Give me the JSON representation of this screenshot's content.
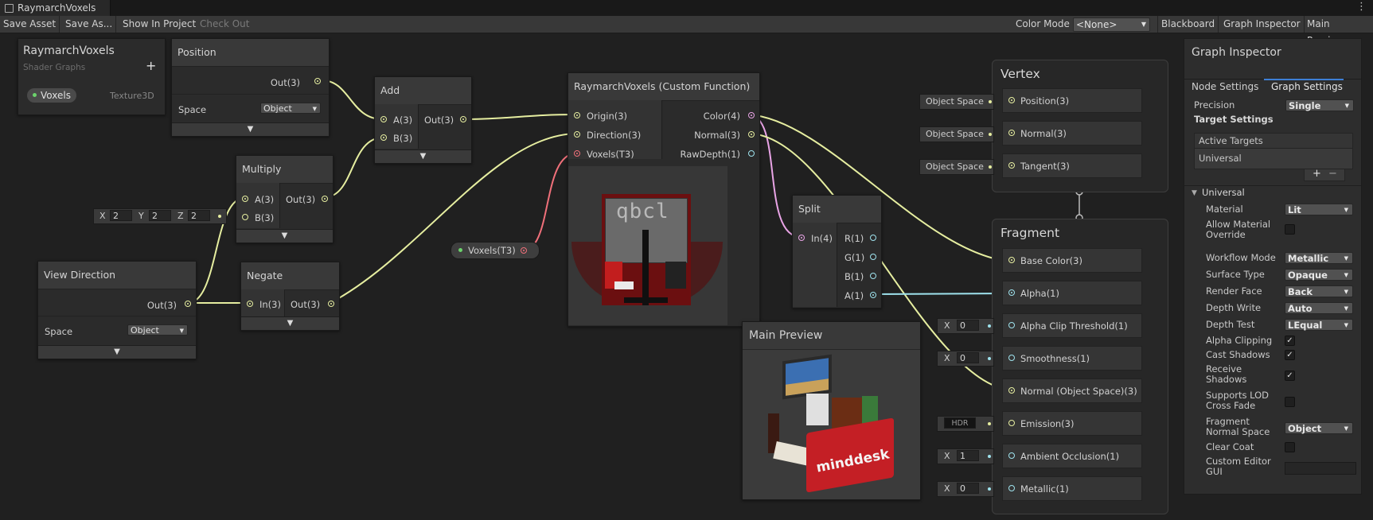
{
  "window": {
    "tab_title": "RaymarchVoxels"
  },
  "toolbar": {
    "save_asset": "Save Asset",
    "save_as": "Save As...",
    "show_in_project": "Show In Project",
    "check_out": "Check Out",
    "color_mode_label": "Color Mode",
    "color_mode_value": "<None>",
    "blackboard": "Blackboard",
    "graph_inspector": "Graph Inspector",
    "main_preview": "Main Preview"
  },
  "blackboard": {
    "title": "RaymarchVoxels",
    "subtitle": "Shader Graphs",
    "add": "+",
    "property_name": "Voxels",
    "property_type": "Texture3D"
  },
  "nodes": {
    "position": {
      "title": "Position",
      "out": "Out(3)",
      "space_label": "Space",
      "space_value": "Object"
    },
    "add": {
      "title": "Add",
      "a": "A(3)",
      "b": "B(3)",
      "out": "Out(3)"
    },
    "multiply": {
      "title": "Multiply",
      "a": "A(3)",
      "b": "B(3)",
      "out": "Out(3)",
      "x_label": "X",
      "x": "2",
      "y_label": "Y",
      "y": "2",
      "z_label": "Z",
      "z": "2"
    },
    "view_direction": {
      "title": "View Direction",
      "out": "Out(3)",
      "space_label": "Space",
      "space_value": "Object"
    },
    "negate": {
      "title": "Negate",
      "in": "In(3)",
      "out": "Out(3)"
    },
    "voxels_property": {
      "label": "Voxels(T3)"
    },
    "custom_function": {
      "title": "RaymarchVoxels (Custom Function)",
      "in_origin": "Origin(3)",
      "in_direction": "Direction(3)",
      "in_voxels": "Voxels(T3)",
      "out_color": "Color(4)",
      "out_normal": "Normal(3)",
      "out_rawdepth": "RawDepth(1)",
      "preview_text": "qbcl"
    },
    "split": {
      "title": "Split",
      "in": "In(4)",
      "r": "R(1)",
      "g": "G(1)",
      "b": "B(1)",
      "a": "A(1)"
    }
  },
  "main_preview": {
    "title": "Main Preview",
    "sign_text": "minddesk"
  },
  "vertex": {
    "title": "Vertex",
    "blocks": [
      {
        "label": "Position(3)",
        "default": "Object Space"
      },
      {
        "label": "Normal(3)",
        "default": "Object Space"
      },
      {
        "label": "Tangent(3)",
        "default": "Object Space"
      }
    ]
  },
  "fragment": {
    "title": "Fragment",
    "blocks": [
      {
        "label": "Base Color(3)"
      },
      {
        "label": "Alpha(1)"
      },
      {
        "label": "Alpha Clip Threshold(1)",
        "x_label": "X",
        "value": "0"
      },
      {
        "label": "Smoothness(1)",
        "x_label": "X",
        "value": "0"
      },
      {
        "label": "Normal (Object Space)(3)"
      },
      {
        "label": "Emission(3)",
        "hdr": "HDR"
      },
      {
        "label": "Ambient Occlusion(1)",
        "x_label": "X",
        "value": "1"
      },
      {
        "label": "Metallic(1)",
        "x_label": "X",
        "value": "0"
      }
    ]
  },
  "inspector": {
    "title": "Graph Inspector",
    "tab_node": "Node Settings",
    "tab_graph": "Graph Settings",
    "precision_label": "Precision",
    "precision_value": "Single",
    "target_settings": "Target Settings",
    "active_targets": "Active Targets",
    "target_universal": "Universal",
    "add": "+",
    "remove": "−",
    "section_universal": "Universal",
    "material_label": "Material",
    "material_value": "Lit",
    "allow_override_label": "Allow Material Override",
    "workflow_label": "Workflow Mode",
    "workflow_value": "Metallic",
    "surface_label": "Surface Type",
    "surface_value": "Opaque",
    "render_face_label": "Render Face",
    "render_face_value": "Back",
    "depth_write_label": "Depth Write",
    "depth_write_value": "Auto",
    "depth_test_label": "Depth Test",
    "depth_test_value": "LEqual",
    "alpha_clipping_label": "Alpha Clipping",
    "cast_shadows_label": "Cast Shadows",
    "receive_shadows_label": "Receive Shadows",
    "lod_label": "Supports LOD Cross Fade",
    "frag_normal_label": "Fragment Normal Space",
    "frag_normal_value": "Object",
    "clear_coat_label": "Clear Coat",
    "custom_gui_label": "Custom Editor GUI",
    "check": "✓"
  },
  "colors": {
    "wire_vector3": "#e6eea0",
    "wire_vector4": "#e9a4e6",
    "wire_float": "#9fe3ee",
    "wire_texture3d": "#f0707a"
  }
}
